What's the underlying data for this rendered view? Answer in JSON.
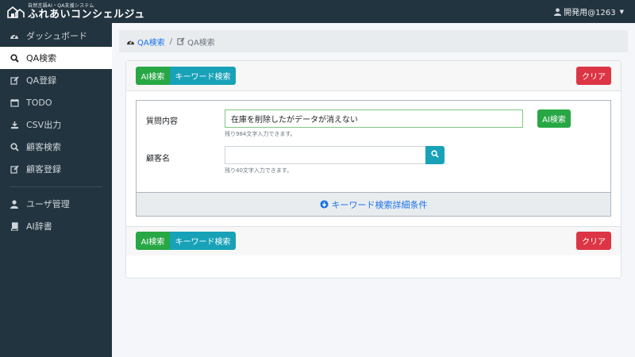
{
  "app": {
    "logo_sub": "自然言語AI・QA支援システム",
    "logo_main": "ふれあいコンシェルジュ",
    "user": "開発用@1263"
  },
  "sidebar": {
    "items": [
      {
        "label": "ダッシュボード",
        "icon": "dashboard-icon"
      },
      {
        "label": "QA検索",
        "icon": "search-icon",
        "active": true
      },
      {
        "label": "QA登録",
        "icon": "edit-icon"
      },
      {
        "label": "TODO",
        "icon": "calendar-icon"
      },
      {
        "label": "CSV出力",
        "icon": "download-icon"
      },
      {
        "label": "顧客検索",
        "icon": "search-icon"
      },
      {
        "label": "顧客登録",
        "icon": "edit-icon"
      }
    ],
    "items2": [
      {
        "label": "ユーザ管理",
        "icon": "user-icon"
      },
      {
        "label": "AI辞書",
        "icon": "book-icon"
      }
    ]
  },
  "breadcrumb": {
    "link": "QA検索",
    "current": "QA検索"
  },
  "toolbar": {
    "ai_label": "AI検索",
    "keyword_label": "キーワード検索",
    "clear_label": "クリア"
  },
  "form": {
    "question_label": "質問内容",
    "question_value": "在庫を削除したがデータが消えない",
    "question_help": "残り984文字入力できます。",
    "ai_button": "AI検索",
    "customer_label": "顧客名",
    "customer_value": "",
    "customer_help": "残り40文字入力できます。",
    "detail_label": "キーワード検索詳細条件"
  },
  "colors": {
    "sidebar_bg": "#22343f",
    "green": "#28a745",
    "teal": "#17a2b8",
    "red": "#dc3545",
    "link": "#1a73e8"
  }
}
